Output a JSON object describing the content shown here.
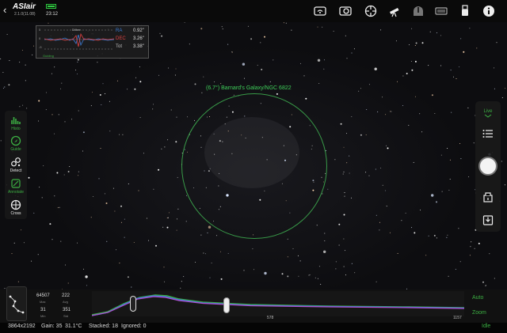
{
  "app": {
    "name": "ASIair",
    "version": "2.1.0(11.08)",
    "time": "23:12"
  },
  "top_icons": [
    "wifi-icon",
    "camera-icon",
    "mount-icon",
    "telescope-icon",
    "observatory-icon",
    "focuser-icon",
    "usb-icon",
    "info-icon"
  ],
  "guide_graph": {
    "title": "Dither",
    "ra_label": "RA",
    "ra_value": "0.92\"",
    "dec_label": "DEC",
    "dec_value": "3.26\"",
    "tot_label": "Tot",
    "tot_value": "3.38\"",
    "status": "Guiding",
    "y_top": "5",
    "y_mid": "0",
    "y_bottom": "-5"
  },
  "object": {
    "label": "(6.7°) Barnard's Galaxy/NGC 6822"
  },
  "left_tools": [
    {
      "label": "Histo",
      "icon": "histogram-icon",
      "active": true
    },
    {
      "label": "Guide",
      "icon": "guide-icon",
      "active": true
    },
    {
      "label": "Detect",
      "icon": "detect-icon",
      "active": false
    },
    {
      "label": "Annotate",
      "icon": "annotate-icon",
      "active": true
    },
    {
      "label": "Cross",
      "icon": "crosshair-icon",
      "active": false
    }
  ],
  "right_tools": {
    "mode_label": "Live",
    "icons": [
      "list-icon",
      "shutter-button",
      "stack-icon",
      "save-icon"
    ]
  },
  "stats": {
    "max": "64507",
    "max_label": "Max",
    "avg": "222",
    "avg_label": "Avg",
    "min": "31",
    "min_label": "Min",
    "std": "351",
    "std_label": "Std"
  },
  "histogram": {
    "axis_mid": "578",
    "axis_end": "1157",
    "auto_label": "Auto",
    "zoom_label": "Zoom"
  },
  "status": {
    "resolution": "3864x2192",
    "gain": "Gain: 35",
    "temp": "31.1°C",
    "stacked": "Stacked: 18",
    "ignored": "Ignored: 0",
    "state": "Idle"
  },
  "colors": {
    "accent_green": "#3cb043",
    "ra_blue": "#3a7bd5",
    "dec_red": "#e04040"
  }
}
